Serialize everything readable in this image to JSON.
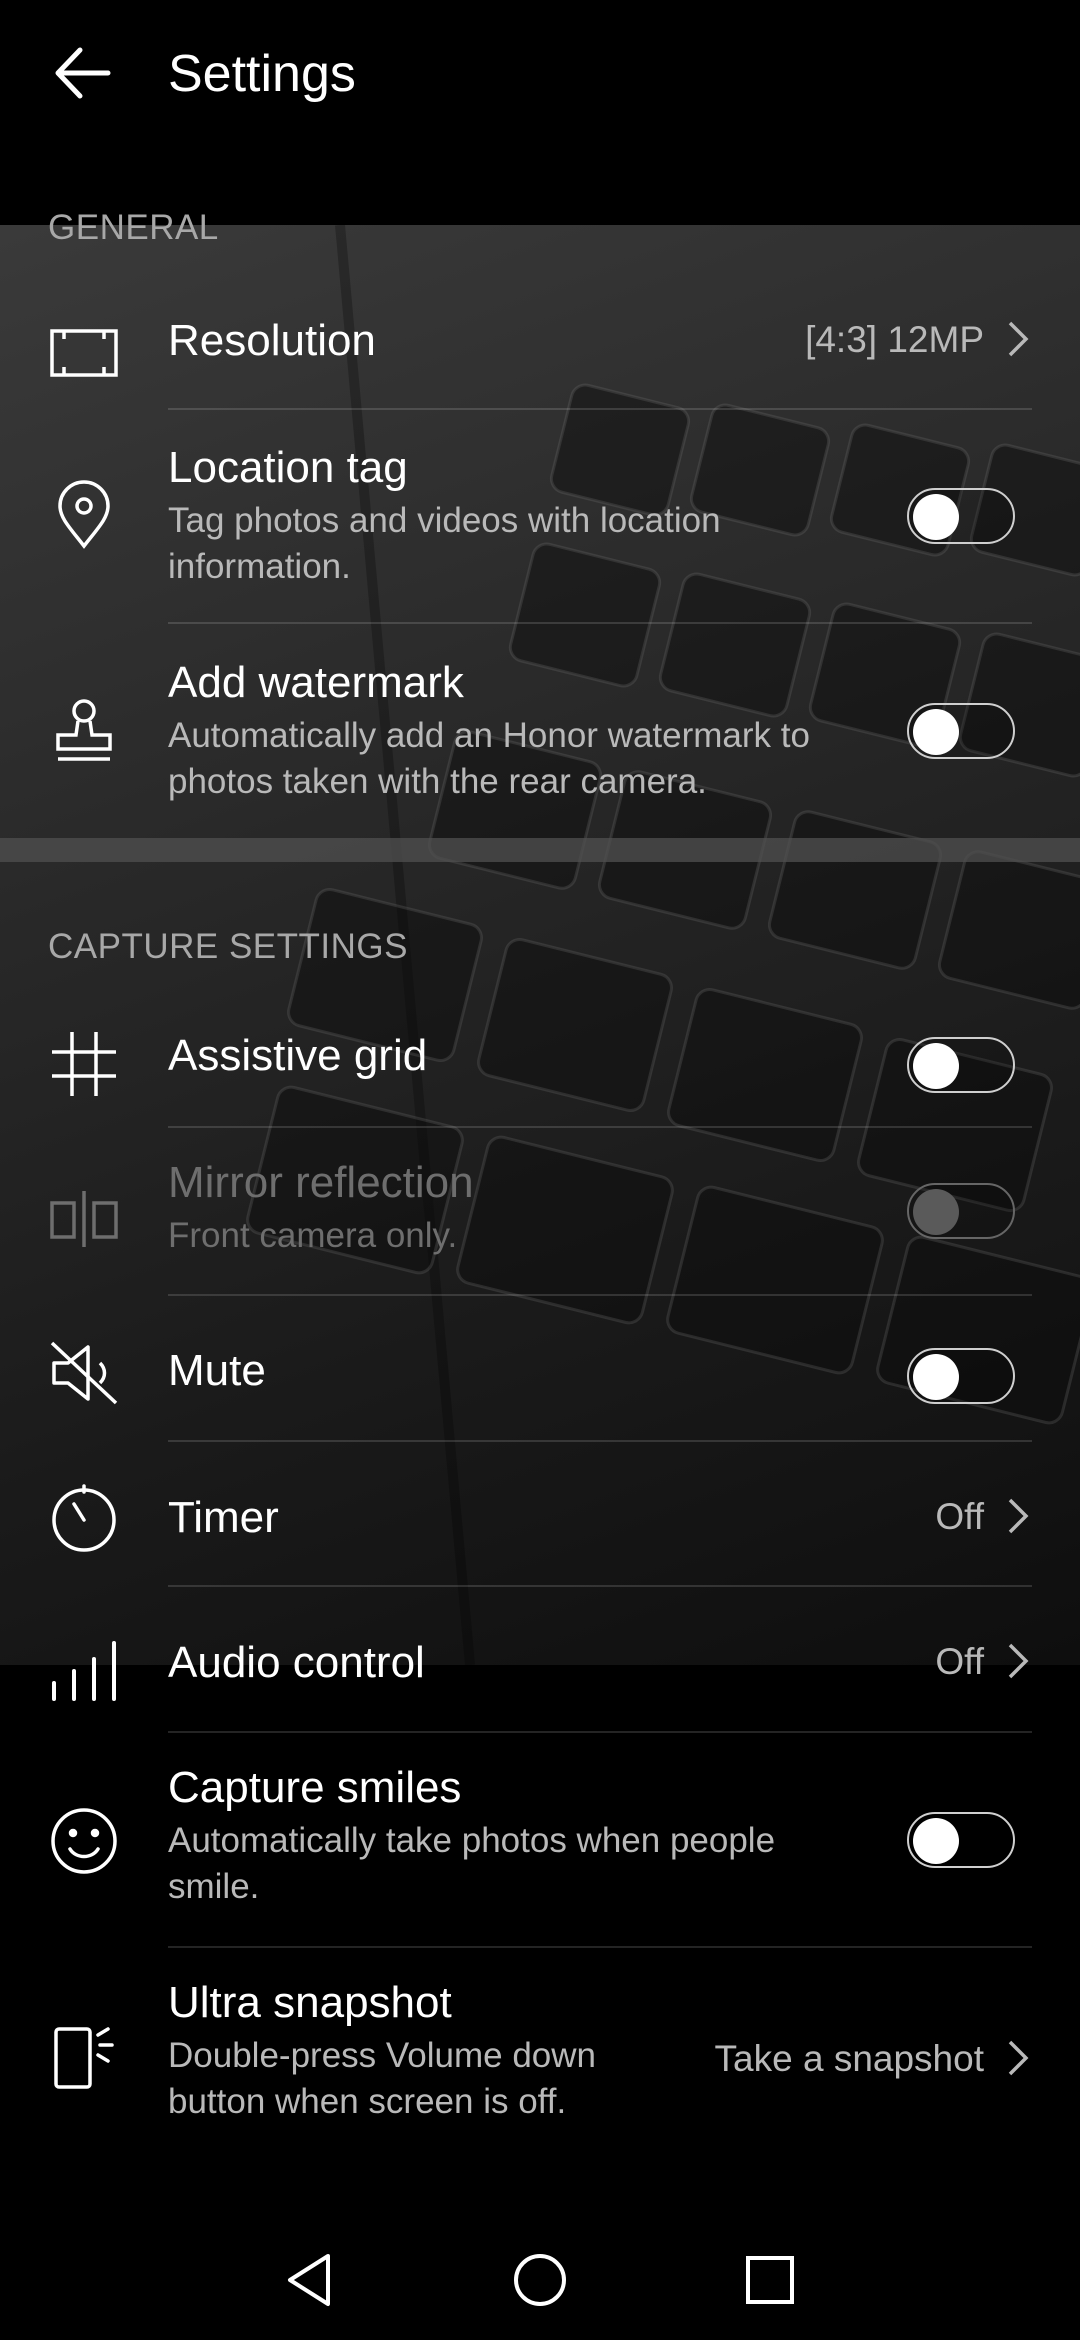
{
  "header": {
    "title": "Settings",
    "back_icon": "arrow-left-icon"
  },
  "sections": {
    "general": "GENERAL",
    "capture": "CAPTURE SETTINGS"
  },
  "general": {
    "resolution": {
      "label": "Resolution",
      "value": "[4:3] 12MP",
      "icon": "resolution-frame-icon"
    },
    "location_tag": {
      "label": "Location tag",
      "sub": "Tag photos and videos with location information.",
      "on": false,
      "icon": "location-pin-icon"
    },
    "watermark": {
      "label": "Add watermark",
      "sub": "Automatically add an Honor watermark to photos taken with the rear camera.",
      "on": false,
      "icon": "stamp-icon"
    }
  },
  "capture": {
    "assistive_grid": {
      "label": "Assistive grid",
      "on": false,
      "icon": "grid-icon"
    },
    "mirror_reflection": {
      "label": "Mirror reflection",
      "sub": "Front camera only.",
      "on": false,
      "enabled": false,
      "icon": "mirror-icon"
    },
    "mute": {
      "label": "Mute",
      "on": false,
      "icon": "speaker-mute-icon"
    },
    "timer": {
      "label": "Timer",
      "value": "Off",
      "icon": "timer-icon"
    },
    "audio_control": {
      "label": "Audio control",
      "value": "Off",
      "icon": "audio-bars-icon"
    },
    "capture_smiles": {
      "label": "Capture smiles",
      "sub": "Automatically take photos when people smile.",
      "on": false,
      "icon": "smiley-icon"
    },
    "ultra_snapshot": {
      "label": "Ultra snapshot",
      "sub": "Double-press Volume down button when screen is off.",
      "value": "Take a snapshot",
      "icon": "phone-volume-icon"
    }
  },
  "navbar": {
    "back": "nav-back-icon",
    "home": "nav-home-icon",
    "recents": "nav-recents-icon"
  },
  "colors": {
    "background": "#000000",
    "secondary_text": "#b9b9b9",
    "section_header": "#a8a8a8"
  }
}
